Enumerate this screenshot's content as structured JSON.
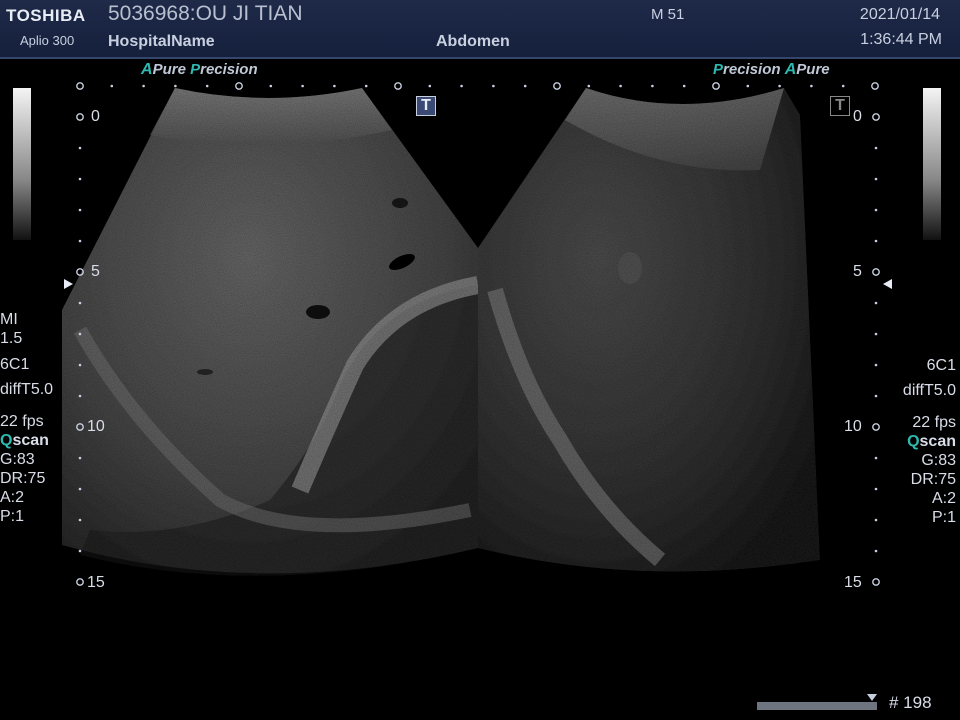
{
  "header": {
    "brand": "TOSHIBA",
    "model": "Aplio 300",
    "patient": "5036968:OU JI TIAN",
    "hospital": "HospitalName",
    "exam": "Abdomen",
    "mode": "M 51",
    "date": "2021/01/14",
    "time": "1:36:44 PM"
  },
  "tags": {
    "left": {
      "a": "A",
      "pure": "Pure",
      "p": "P",
      "precision": "recision"
    },
    "right": {
      "p": "P",
      "precision": "recision",
      "a": "A",
      "pure": "Pure"
    }
  },
  "depth_scale": {
    "d0": "0",
    "d5": "5",
    "d10": "10",
    "d15": "15"
  },
  "left_params": {
    "mi_label": "MI",
    "mi_value": "1.5",
    "probe": "6C1",
    "harmonic": "diffT5.0",
    "fps": "22 fps",
    "qscan_q": "Q",
    "qscan_rest": "scan",
    "gain": "G:83",
    "dr": "DR:75",
    "a": "A:2",
    "p": "P:1"
  },
  "right_params": {
    "probe": "6C1",
    "harmonic": "diffT5.0",
    "fps": "22 fps",
    "qscan_q": "Q",
    "qscan_rest": "scan",
    "gain": "G:83",
    "dr": "DR:75",
    "a": "A:2",
    "p": "P:1"
  },
  "markers": {
    "t": "T"
  },
  "cine": {
    "frame": "# 198",
    "progress": 0.96
  },
  "colors": {
    "accent": "#2fb8b0",
    "header_bg": "#1e2a48"
  }
}
